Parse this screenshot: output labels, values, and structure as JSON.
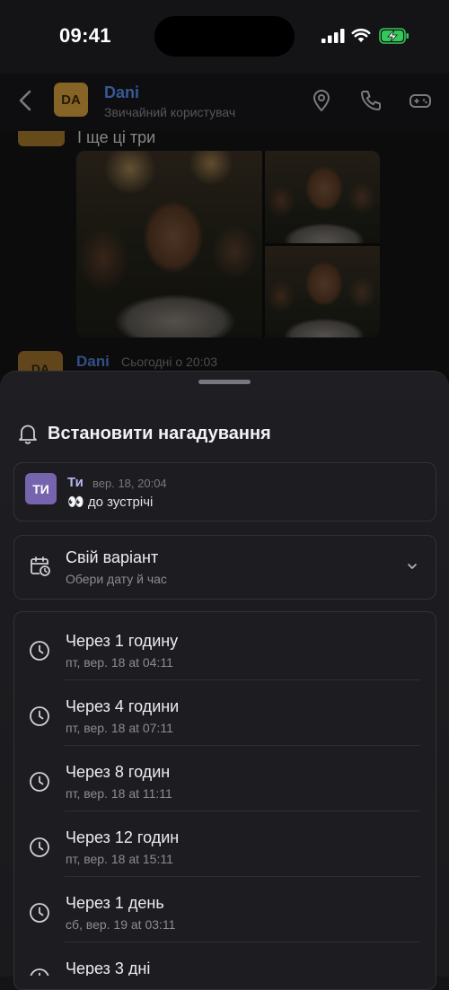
{
  "status_bar": {
    "time": "09:41"
  },
  "header": {
    "avatar_initials": "DA",
    "name": "Dani",
    "subtitle": "Звичайний користувач"
  },
  "chat": {
    "message_text": "І ще ці три",
    "next_message": {
      "author": "Dani",
      "time": "Сьогодні о 20:03"
    }
  },
  "sheet": {
    "title": "Встановити нагадування",
    "quoted_message": {
      "avatar_initials": "ТИ",
      "author": "Ти",
      "time": "вер. 18, 20:04",
      "text": "👀 до зустрічі"
    },
    "custom_option": {
      "title": "Свій варіант",
      "subtitle": "Обери дату й час"
    },
    "options": [
      {
        "title": "Через 1 годину",
        "subtitle": "пт, вер. 18 at 04:11"
      },
      {
        "title": "Через 4 години",
        "subtitle": "пт, вер. 18 at 07:11"
      },
      {
        "title": "Через 8 годин",
        "subtitle": "пт, вер. 18 at 11:11"
      },
      {
        "title": "Через 12 годин",
        "subtitle": "пт, вер. 18 at 15:11"
      },
      {
        "title": "Через 1 день",
        "subtitle": "сб, вер. 19 at 03:11"
      },
      {
        "title": "Через 3 дні",
        "subtitle": ""
      }
    ]
  },
  "colors": {
    "accent_blue": "#5a8ff0",
    "avatar_yellow": "#d9a23d",
    "avatar_purple": "#7764ae",
    "battery_green": "#34c759"
  }
}
